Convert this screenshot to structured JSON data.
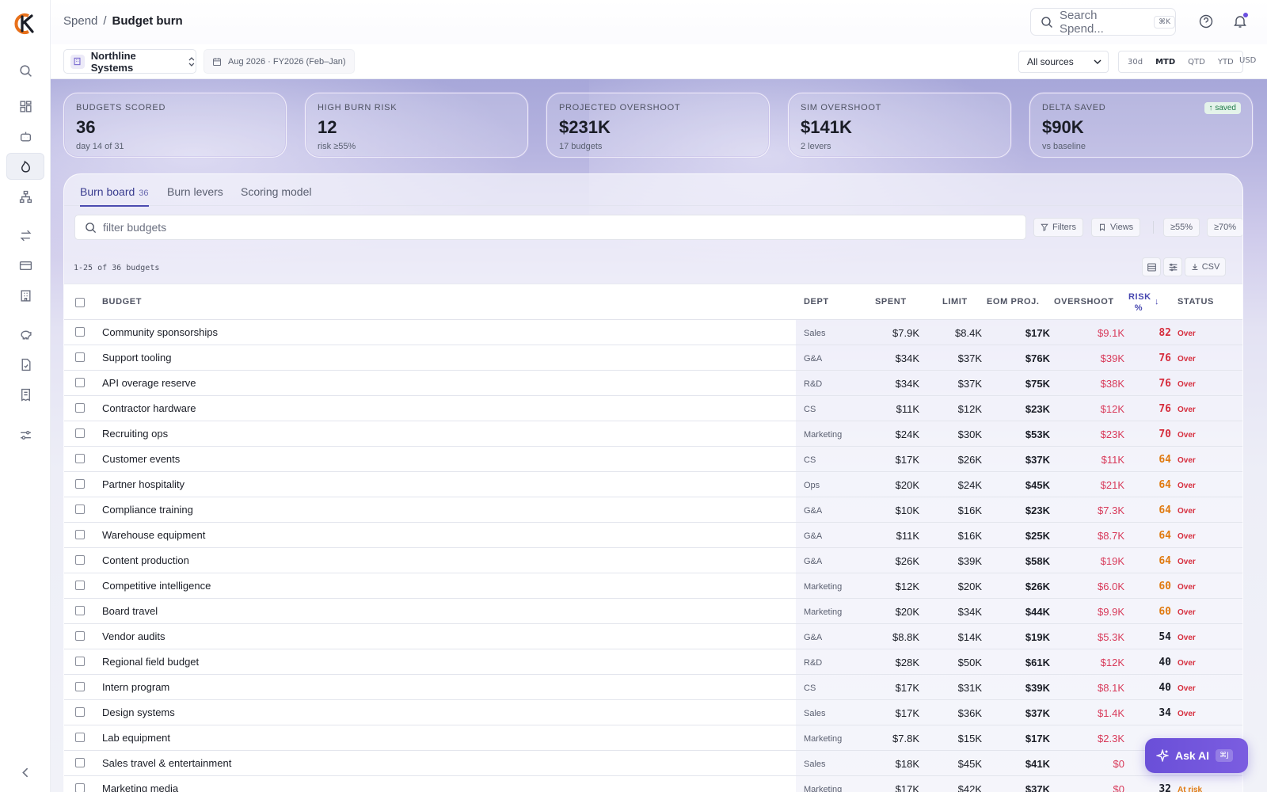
{
  "header": {
    "breadcrumb": [
      "Spend",
      "Budget burn"
    ],
    "search_placeholder": "Search Spend...",
    "search_kbd": "⌘K"
  },
  "controls": {
    "entity": "Northline Systems",
    "period": "Aug 2026 · FY2026 (Feb–Jan)",
    "sources": "All sources",
    "ranges": [
      "30d",
      "MTD",
      "QTD",
      "YTD"
    ],
    "active_range": "MTD",
    "currency": "USD"
  },
  "kpis": [
    {
      "label": "Budgets scored",
      "value": "36",
      "sub": "day 14 of 31"
    },
    {
      "label": "High burn risk",
      "value": "12",
      "sub": "risk ≥55%"
    },
    {
      "label": "Projected overshoot",
      "value": "$231K",
      "sub": "17 budgets"
    },
    {
      "label": "Sim overshoot",
      "value": "$141K",
      "sub": "2 levers"
    },
    {
      "label": "Delta saved",
      "value": "$90K",
      "sub": "vs baseline",
      "badge": "saved"
    }
  ],
  "tabs": [
    {
      "label": "Burn board",
      "count": "36"
    },
    {
      "label": "Burn levers"
    },
    {
      "label": "Scoring model"
    }
  ],
  "toolbar": {
    "filter_placeholder": "filter budgets",
    "filters": "Filters",
    "views": "Views",
    "chip1": "≥55%",
    "chip2": "≥70%",
    "count": "1-25 of 36 budgets",
    "csv": "CSV"
  },
  "table": {
    "headers": {
      "budget": "Budget",
      "dept": "Dept",
      "spent": "Spent",
      "limit": "Limit",
      "eom": "EOM proj.",
      "overshoot": "Overshoot",
      "risk": "Risk %",
      "status": "Status"
    },
    "rows": [
      {
        "budget": "Community sponsorships",
        "dept": "Sales",
        "spent": "$7.9K",
        "limit": "$8.4K",
        "eom": "$17K",
        "overshoot": "$9.1K",
        "risk": "82",
        "status": "Over"
      },
      {
        "budget": "Support tooling",
        "dept": "G&A",
        "spent": "$34K",
        "limit": "$37K",
        "eom": "$76K",
        "overshoot": "$39K",
        "risk": "76",
        "status": "Over"
      },
      {
        "budget": "API overage reserve",
        "dept": "R&D",
        "spent": "$34K",
        "limit": "$37K",
        "eom": "$75K",
        "overshoot": "$38K",
        "risk": "76",
        "status": "Over"
      },
      {
        "budget": "Contractor hardware",
        "dept": "CS",
        "spent": "$11K",
        "limit": "$12K",
        "eom": "$23K",
        "overshoot": "$12K",
        "risk": "76",
        "status": "Over"
      },
      {
        "budget": "Recruiting ops",
        "dept": "Marketing",
        "spent": "$24K",
        "limit": "$30K",
        "eom": "$53K",
        "overshoot": "$23K",
        "risk": "70",
        "status": "Over"
      },
      {
        "budget": "Customer events",
        "dept": "CS",
        "spent": "$17K",
        "limit": "$26K",
        "eom": "$37K",
        "overshoot": "$11K",
        "risk": "64",
        "status": "Over"
      },
      {
        "budget": "Partner hospitality",
        "dept": "Ops",
        "spent": "$20K",
        "limit": "$24K",
        "eom": "$45K",
        "overshoot": "$21K",
        "risk": "64",
        "status": "Over"
      },
      {
        "budget": "Compliance training",
        "dept": "G&A",
        "spent": "$10K",
        "limit": "$16K",
        "eom": "$23K",
        "overshoot": "$7.3K",
        "risk": "64",
        "status": "Over"
      },
      {
        "budget": "Warehouse equipment",
        "dept": "G&A",
        "spent": "$11K",
        "limit": "$16K",
        "eom": "$25K",
        "overshoot": "$8.7K",
        "risk": "64",
        "status": "Over"
      },
      {
        "budget": "Content production",
        "dept": "G&A",
        "spent": "$26K",
        "limit": "$39K",
        "eom": "$58K",
        "overshoot": "$19K",
        "risk": "64",
        "status": "Over"
      },
      {
        "budget": "Competitive intelligence",
        "dept": "Marketing",
        "spent": "$12K",
        "limit": "$20K",
        "eom": "$26K",
        "overshoot": "$6.0K",
        "risk": "60",
        "status": "Over"
      },
      {
        "budget": "Board travel",
        "dept": "Marketing",
        "spent": "$20K",
        "limit": "$34K",
        "eom": "$44K",
        "overshoot": "$9.9K",
        "risk": "60",
        "status": "Over"
      },
      {
        "budget": "Vendor audits",
        "dept": "G&A",
        "spent": "$8.8K",
        "limit": "$14K",
        "eom": "$19K",
        "overshoot": "$5.3K",
        "risk": "54",
        "status": "Over"
      },
      {
        "budget": "Regional field budget",
        "dept": "R&D",
        "spent": "$28K",
        "limit": "$50K",
        "eom": "$61K",
        "overshoot": "$12K",
        "risk": "40",
        "status": "Over"
      },
      {
        "budget": "Intern program",
        "dept": "CS",
        "spent": "$17K",
        "limit": "$31K",
        "eom": "$39K",
        "overshoot": "$8.1K",
        "risk": "40",
        "status": "Over"
      },
      {
        "budget": "Design systems",
        "dept": "Sales",
        "spent": "$17K",
        "limit": "$36K",
        "eom": "$37K",
        "overshoot": "$1.4K",
        "risk": "34",
        "status": "Over"
      },
      {
        "budget": "Lab equipment",
        "dept": "Marketing",
        "spent": "$7.8K",
        "limit": "$15K",
        "eom": "$17K",
        "overshoot": "$2.3K",
        "risk": "",
        "status": ""
      },
      {
        "budget": "Sales travel & entertainment",
        "dept": "Sales",
        "spent": "$18K",
        "limit": "$45K",
        "eom": "$41K",
        "overshoot": "$0",
        "risk": "",
        "status": ""
      },
      {
        "budget": "Marketing media",
        "dept": "Marketing",
        "spent": "$17K",
        "limit": "$42K",
        "eom": "$37K",
        "overshoot": "$0",
        "risk": "32",
        "status": "At risk"
      }
    ]
  },
  "ask_ai": {
    "label": "Ask AI",
    "kbd": "⌘J"
  }
}
